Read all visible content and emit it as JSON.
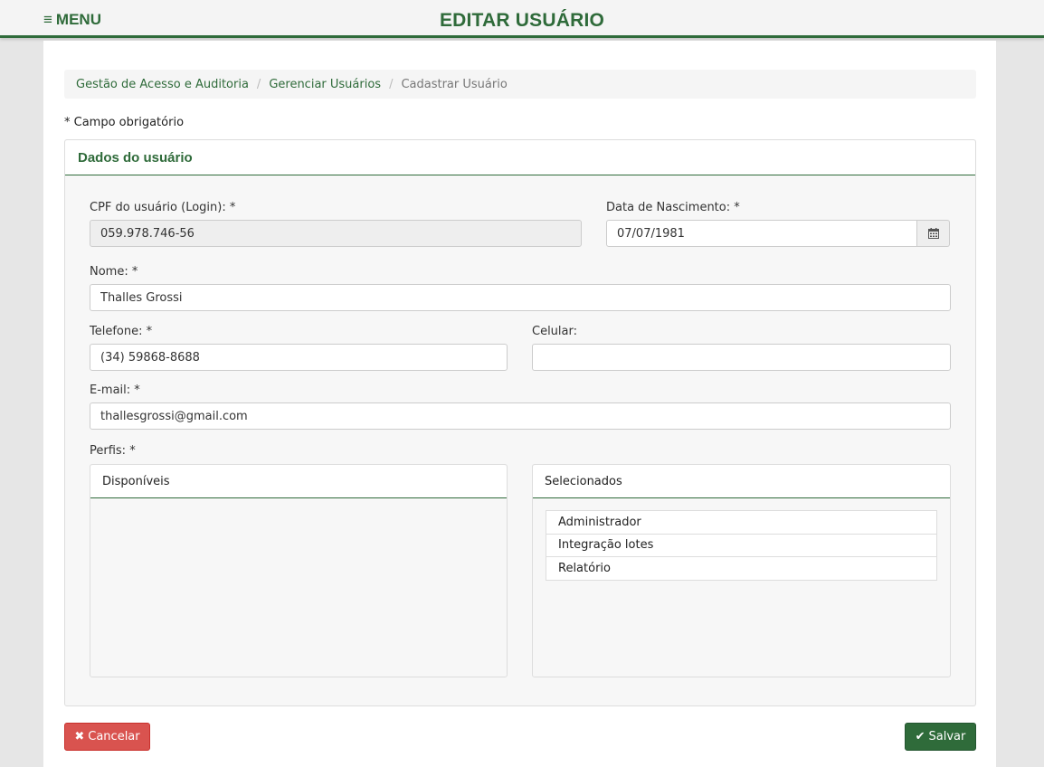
{
  "header": {
    "menu_icon": "≡",
    "menu_label": "MENU",
    "title": "EDITAR USUÁRIO"
  },
  "breadcrumb": {
    "items": [
      "Gestão de Acesso e Auditoria",
      "Gerenciar Usuários",
      "Cadastrar Usuário"
    ],
    "separator": "/"
  },
  "required_note": "* Campo obrigatório",
  "panel": {
    "title": "Dados do usuário"
  },
  "form": {
    "cpf_label": "CPF do usuário (Login): *",
    "cpf_value": "059.978.746-56",
    "birth_label": "Data de Nascimento: *",
    "birth_value": "07/07/1981",
    "name_label": "Nome: *",
    "name_value": "Thalles Grossi",
    "phone_label": "Telefone: *",
    "phone_value": "(34) 59868-8688",
    "mobile_label": "Celular:",
    "mobile_value": "",
    "email_label": "E-mail: *",
    "email_value": "thallesgrossi@gmail.com",
    "profiles_label": "Perfis: *"
  },
  "profiles": {
    "available_title": "Disponíveis",
    "available_items": [],
    "selected_title": "Selecionados",
    "selected_items": [
      "Administrador",
      "Integração lotes",
      "Relatório"
    ]
  },
  "actions": {
    "cancel_icon": "✖",
    "cancel_label": "Cancelar",
    "save_icon": "✔",
    "save_label": "Salvar"
  },
  "colors": {
    "brand": "#2f6b3a",
    "danger": "#d9534f"
  },
  "icons": {
    "calendar": "calendar-icon"
  }
}
